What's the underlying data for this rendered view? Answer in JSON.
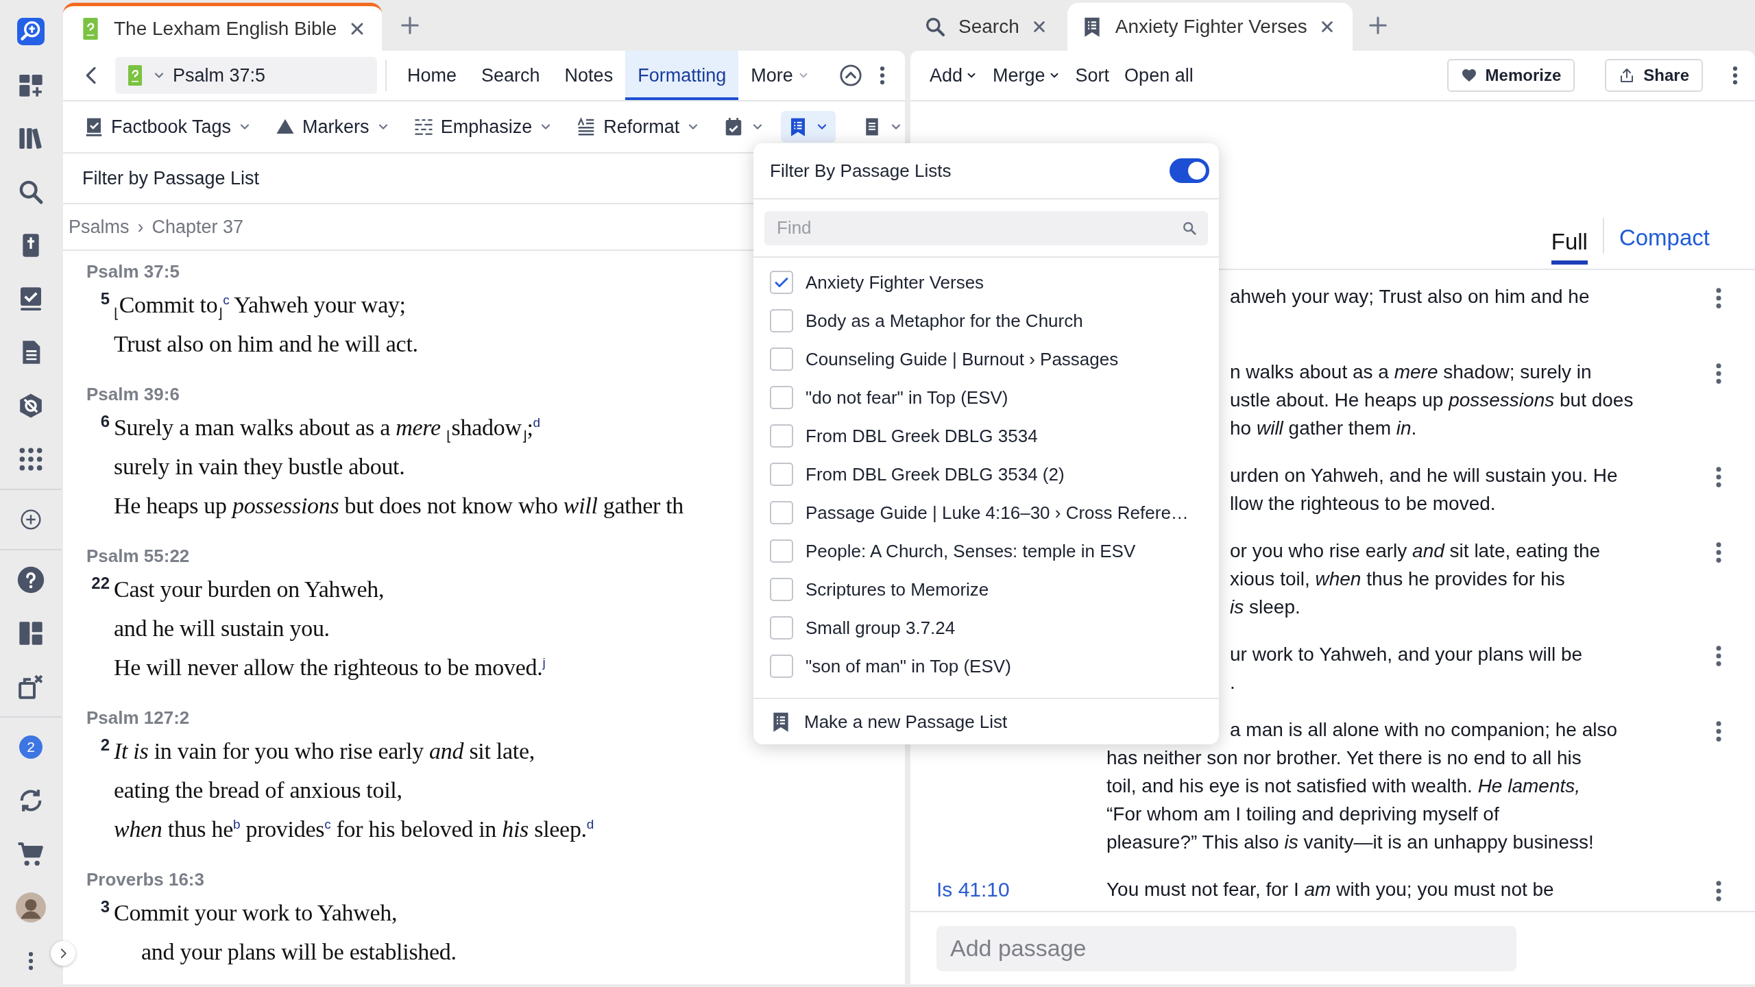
{
  "rail": {
    "badge": "2"
  },
  "left_pane": {
    "tabs": [
      {
        "label": "The Lexham English Bible",
        "selected": true
      }
    ],
    "reference": "Psalm 37:5",
    "nav": [
      {
        "label": "Home",
        "selected": false,
        "menu": false
      },
      {
        "label": "Search",
        "selected": false,
        "menu": false
      },
      {
        "label": "Notes",
        "selected": false,
        "menu": false
      },
      {
        "label": "Formatting",
        "selected": true,
        "menu": false
      },
      {
        "label": "More",
        "selected": false,
        "menu": true
      }
    ],
    "tools": [
      {
        "kind": "factbook",
        "label": "Factbook Tags",
        "selected": false
      },
      {
        "kind": "markers",
        "label": "Markers",
        "selected": false
      },
      {
        "kind": "emphasize",
        "label": "Emphasize",
        "selected": false
      },
      {
        "kind": "reformat",
        "label": "Reformat",
        "selected": false
      },
      {
        "kind": "calendar",
        "selected": false
      },
      {
        "kind": "passage_list",
        "selected": true
      },
      {
        "kind": "document",
        "selected": false
      }
    ],
    "filter_label": "Filter by Passage List",
    "breadcrumb": {
      "items": [
        "Psalms",
        "Chapter 37"
      ],
      "separator": "›"
    },
    "passages": [
      {
        "heading": "Psalm 37:5",
        "verse": "5",
        "lines": [
          "$_{⌊}$Commit to$_{⌋}$$^{c}$ Yahweh your way;",
          "Trust also on him and he will act."
        ]
      },
      {
        "heading": "Psalm 39:6",
        "verse": "6",
        "lines": [
          "Surely a man walks about as a *mere* $_{⌊}$shadow$_{⌋}$;$^{d}$",
          "surely in vain they bustle about.",
          "He heaps up *possessions* but does not know who *will* gather th"
        ]
      },
      {
        "heading": "Psalm 55:22",
        "verse": "22",
        "lines": [
          "Cast your burden on Yahweh,",
          "and he will sustain you.",
          "He will never allow the righteous to be moved.$^{j}$"
        ]
      },
      {
        "heading": "Psalm 127:2",
        "verse": "2",
        "lines": [
          "*It is* in vain for you who rise early *and* sit late,",
          "eating the bread of anxious toil,",
          "*when* thus he$^{b}$ provides$^{c}$ for his beloved in *his* sleep.$^{d}$"
        ]
      },
      {
        "heading": "Proverbs 16:3",
        "verse": "3",
        "lines": [
          "Commit your work to Yahweh,",
          "and your plans will be established."
        ]
      }
    ]
  },
  "right_pane": {
    "tabs": [
      {
        "kind": "search",
        "label": "Search",
        "selected": false
      },
      {
        "kind": "list",
        "label": "Anxiety Fighter Verses",
        "selected": true
      }
    ],
    "actions": [
      {
        "label": "Add",
        "menu": true
      },
      {
        "label": "Merge",
        "menu": true
      },
      {
        "label": "Sort",
        "menu": false
      },
      {
        "label": "Open all",
        "menu": false
      }
    ],
    "buttons": [
      {
        "kind": "heart",
        "label": "Memorize"
      },
      {
        "kind": "share",
        "label": "Share"
      }
    ],
    "views": [
      {
        "label": "Full",
        "selected": true
      },
      {
        "label": "Compact",
        "selected": false
      }
    ],
    "rows": [
      {
        "lines": [
          "ahweh your way; Trust also on him and he"
        ]
      },
      {
        "lines": [
          "n walks about as a *mere* shadow; surely in",
          "ustle about. He heaps up *possessions* but does",
          "ho *will* gather them *in*."
        ]
      },
      {
        "lines": [
          "urden on Yahweh, and he will sustain you. He",
          "llow the righteous to be moved."
        ]
      },
      {
        "lines": [
          "or you who rise early *and* sit late, eating the",
          "xious toil, *when* thus he provides for his",
          "*is* sleep."
        ]
      },
      {
        "lines": [
          "ur work to Yahweh, and your plans will be",
          "."
        ]
      },
      {
        "lines": [
          "a man is all alone with no companion; he also",
          "has neither son nor brother. Yet there is no end to all his",
          "toil, and his eye is not satisfied with wealth. *He laments,*",
          "“For whom am I toiling and depriving myself of",
          "pleasure?” This also *is* vanity—it is an unhappy business!"
        ]
      },
      {
        "ref": "Is 41:10",
        "lines": [
          "You must not fear, for I *am* with you; you must not be"
        ]
      }
    ],
    "add_passage": {
      "placeholder": "Add passage"
    }
  },
  "filter_popup": {
    "title": "Filter By Passage Lists",
    "enabled": true,
    "search": {
      "placeholder": "Find"
    },
    "lists": [
      {
        "label": "Anxiety Fighter Verses",
        "checked": true
      },
      {
        "label": "Body as a Metaphor for the Church",
        "checked": false
      },
      {
        "label": "Counseling Guide | Burnout › Passages",
        "checked": false
      },
      {
        "label": "\"do not fear\" in Top (ESV)",
        "checked": false
      },
      {
        "label": "From DBL Greek DBLG 3534",
        "checked": false
      },
      {
        "label": "From DBL Greek DBLG 3534 (2)",
        "checked": false
      },
      {
        "label": "Passage Guide | Luke 4:16–30 › Cross Refere…",
        "checked": false
      },
      {
        "label": "People: A Church, Senses: temple in ESV",
        "checked": false
      },
      {
        "label": "Scriptures to Memorize",
        "checked": false
      },
      {
        "label": "Small group 3.7.24",
        "checked": false
      },
      {
        "label": "\"son of man\" in Top (ESV)",
        "checked": false
      }
    ],
    "new_list": "Make a new Passage List"
  }
}
